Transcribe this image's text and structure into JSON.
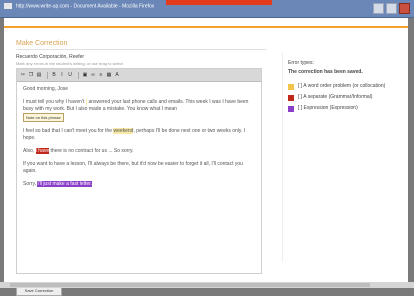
{
  "window": {
    "title": "http://www.write-up.com - Document Available - Mozilla Firefox"
  },
  "form": {
    "section_title": "Make Correction",
    "recipient": "Recuerdo Corporación, Reefer",
    "hint": "Mark any errors in the student's writing, or use drag to select",
    "save_label": "Save Correction"
  },
  "toolbar": [
    {
      "icon": "cut-icon",
      "glyph": "✂"
    },
    {
      "icon": "copy-icon",
      "glyph": "❐"
    },
    {
      "icon": "paste-icon",
      "glyph": "▤"
    },
    {
      "sep": true
    },
    {
      "icon": "bold-icon",
      "glyph": "B"
    },
    {
      "icon": "italic-icon",
      "glyph": "I"
    },
    {
      "icon": "underline-icon",
      "glyph": "U"
    },
    {
      "sep": true
    },
    {
      "icon": "image-icon",
      "glyph": "▣"
    },
    {
      "icon": "link-icon",
      "glyph": "∞"
    },
    {
      "icon": "list-icon",
      "glyph": "≡"
    },
    {
      "icon": "table-icon",
      "glyph": "▦"
    },
    {
      "icon": "color-icon",
      "glyph": "A"
    }
  ],
  "letter": {
    "greeting": "Good morning, Jose",
    "p1_a": "I must tell you why I haven't",
    "p1_mark": "",
    "p1_b": "answered your last phone calls and emails. This week I was",
    "p1_c": "I have been busy with my work. But I also made a mistake. You know what I mean",
    "tooltip": "Note on this phrase",
    "p2_a": "I feel so bad that I can't meet you for the",
    "p2_mark": "weekend",
    "p2_b": ", perhaps I'll be done next one or two weeks only. I hope.",
    "p3_a": "Also,",
    "p3_err": "I have",
    "p3_b": "there is no contract for us ... So sorry.",
    "p4": "If you want to have a lesson, I'll always be there, but it'd now be easier to forget it all, I'll contact you again.",
    "p5_a": "Sorry,",
    "p5_err": "I'll just make a fast letter."
  },
  "sidebar": {
    "label": "Error types:",
    "heading": "The correction has been saved.",
    "legend": [
      {
        "color": "#f3c34a",
        "text": "[ ] A word order problem (or collocation)"
      },
      {
        "color": "#c0281a",
        "text": "[ ] A separate (Grammar/Informal)"
      },
      {
        "color": "#8a3fc9",
        "text": "[ ] Expression (Expression)"
      }
    ]
  }
}
